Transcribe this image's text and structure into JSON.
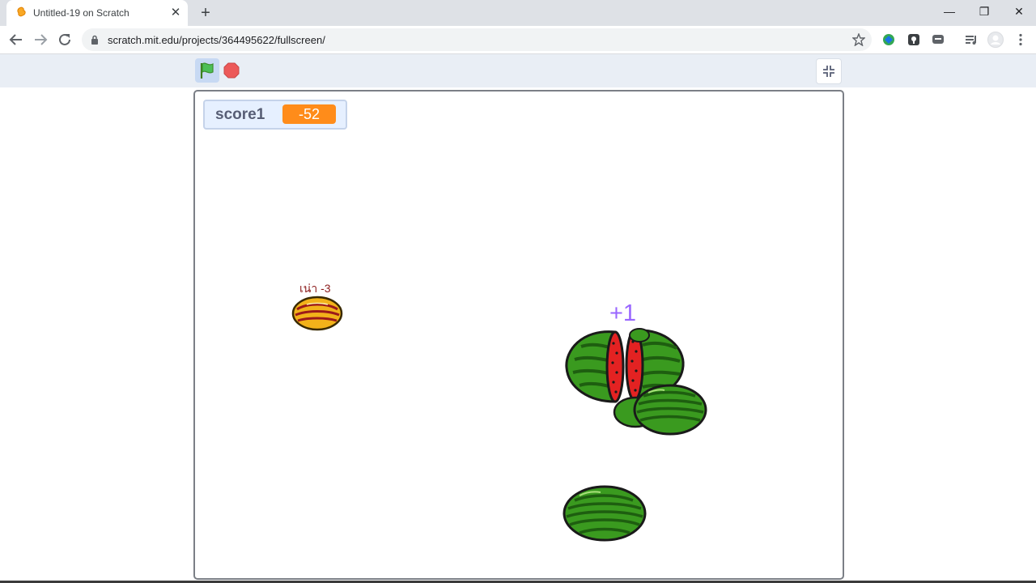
{
  "browser": {
    "tab_title": "Untitled-19 on Scratch",
    "tab_close": "✕",
    "new_tab": "+",
    "url": "scratch.mit.edu/projects/364495622/fullscreen/",
    "window_controls": {
      "minimize": "—",
      "restore": "❐",
      "close": "✕"
    }
  },
  "player": {
    "flag_active": true
  },
  "stage": {
    "monitor": {
      "label": "score1",
      "value": "-52",
      "value_color": "#ff8c1a"
    },
    "texts": {
      "melon_label": "เน่า -3",
      "plus_one": "+1"
    }
  },
  "colors": {
    "watermelon_rind": "#3a9a1f",
    "watermelon_stripe": "#1e5e10",
    "watermelon_flesh": "#e32222",
    "rotten_melon": "#f0b01a",
    "plus_text": "#9966ff"
  }
}
